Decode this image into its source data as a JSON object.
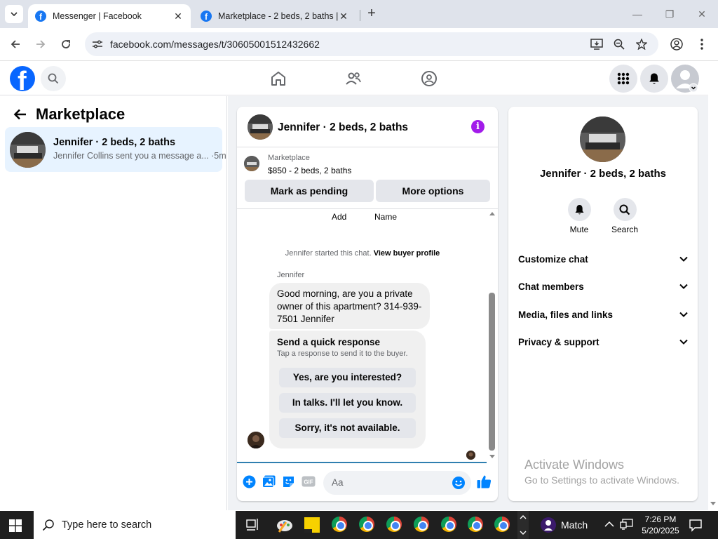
{
  "browser": {
    "tabs": [
      {
        "title": "Messenger | Facebook",
        "active": true
      },
      {
        "title": "Marketplace - 2 beds, 2 baths |",
        "active": false
      }
    ],
    "url": "facebook.com/messages/t/30605001512432662"
  },
  "left_panel": {
    "title": "Marketplace",
    "conversation": {
      "name": "Jennifer · 2 beds, 2 baths",
      "preview": "Jennifer Collins sent you a message a... ·5m"
    }
  },
  "chat": {
    "header_name": "Jennifer · 2 beds, 2 baths",
    "listing": {
      "source": "Marketplace",
      "price_title": "$850 - 2 beds, 2 baths",
      "mark_pending_label": "Mark as pending",
      "more_options_label": "More options"
    },
    "top_labels": {
      "add": "Add",
      "name": "Name"
    },
    "started_text": "Jennifer started this chat.",
    "view_buyer_profile": "View buyer profile",
    "sender": "Jennifer",
    "message": "Good morning, are you a private owner of this apartment? 314-939-7501 Jennifer",
    "quick_response": {
      "title": "Send a quick response",
      "subtitle": "Tap a response to send it to the buyer.",
      "options": [
        "Yes, are you interested?",
        "In talks. I'll let you know.",
        "Sorry, it's not available."
      ]
    },
    "composer": {
      "placeholder": "Aa",
      "gif_label": "GIF"
    }
  },
  "info_panel": {
    "name": "Jennifer · 2 beds, 2 baths",
    "actions": [
      {
        "label": "Mute",
        "icon": "bell-icon"
      },
      {
        "label": "Search",
        "icon": "search-icon"
      }
    ],
    "sections": [
      "Customize chat",
      "Chat members",
      "Media, files and links",
      "Privacy & support"
    ]
  },
  "watermark": {
    "line1": "Activate Windows",
    "line2": "Go to Settings to activate Windows."
  },
  "taskbar": {
    "search_placeholder": "Type here to search",
    "weather_label": "Match",
    "time": "7:26 PM",
    "date": "5/20/2025"
  },
  "colors": {
    "facebook_blue": "#0866ff",
    "messenger_blue": "#0084ff",
    "info_purple": "#a21bea",
    "selected_bg": "#e7f3ff"
  }
}
